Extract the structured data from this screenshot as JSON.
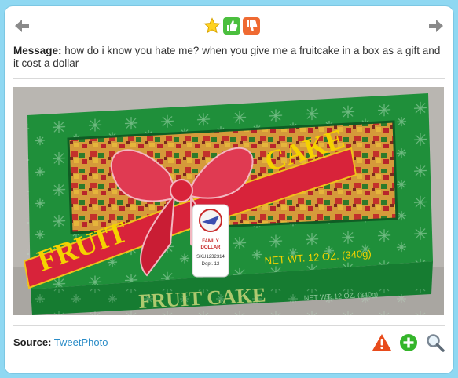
{
  "message": {
    "label": "Message:",
    "text": "how do i know you hate me? when you give me a fruitcake in a box as a gift and it cost a dollar"
  },
  "photo": {
    "box_top_text": "FRUIT CAKE",
    "ribbon_left": "FRUIT",
    "ribbon_right": "CAKE",
    "net_weight": "NET WT. 12 OZ. (340g)",
    "brand_line1": "FAMILY",
    "brand_line2": "DOLLAR",
    "sku": "SKU1232314",
    "dept": "Dept. 12",
    "front_bottom_text": "FRUIT CAKE",
    "front_bottom_small": "NET WT. 12 OZ. (340g)"
  },
  "source": {
    "label": "Source:",
    "link": "TweetPhoto"
  },
  "colors": {
    "background": "#8fd8f2",
    "link": "#2a8cc7",
    "box_green": "#1f8f3a",
    "ribbon_red": "#d8233a",
    "label_yellow": "#f5d200"
  },
  "icons": {
    "prev": "left-arrow-icon",
    "next": "right-arrow-icon",
    "favorite": "star-icon",
    "like": "thumbs-up-icon",
    "dislike": "thumbs-down-icon",
    "report": "warning-icon",
    "add": "plus-icon",
    "zoom": "magnifier-icon"
  }
}
